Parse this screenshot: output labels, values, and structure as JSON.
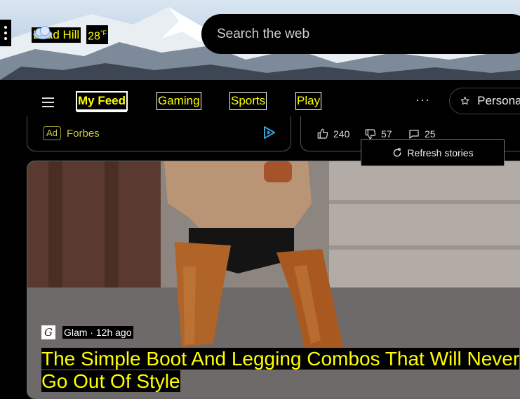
{
  "header": {
    "location": "Lead Hill",
    "temperature": "28",
    "temp_unit": "°F",
    "weather_icon": "cloud-icon",
    "search_placeholder": "Search the web"
  },
  "nav": {
    "tabs": [
      {
        "label": "My Feed",
        "active": true
      },
      {
        "label": "Gaming",
        "active": false
      },
      {
        "label": "Sports",
        "active": false
      },
      {
        "label": "Play",
        "active": false
      }
    ],
    "more_label": "···",
    "personalize_label": "Personalize"
  },
  "ad_card": {
    "badge": "Ad",
    "source": "Forbes"
  },
  "stats_card": {
    "likes": "240",
    "dislikes": "57",
    "comments": "25"
  },
  "tooltip": {
    "label": "Refresh stories"
  },
  "main_article": {
    "source": "Glam · 12h ago",
    "headline": "The Simple Boot And Legging Combos That Will Never Go Out Of Style"
  },
  "colors": {
    "highlight_text": "#ffff00",
    "background": "#000000",
    "accent_play": "#3aa0d8"
  }
}
